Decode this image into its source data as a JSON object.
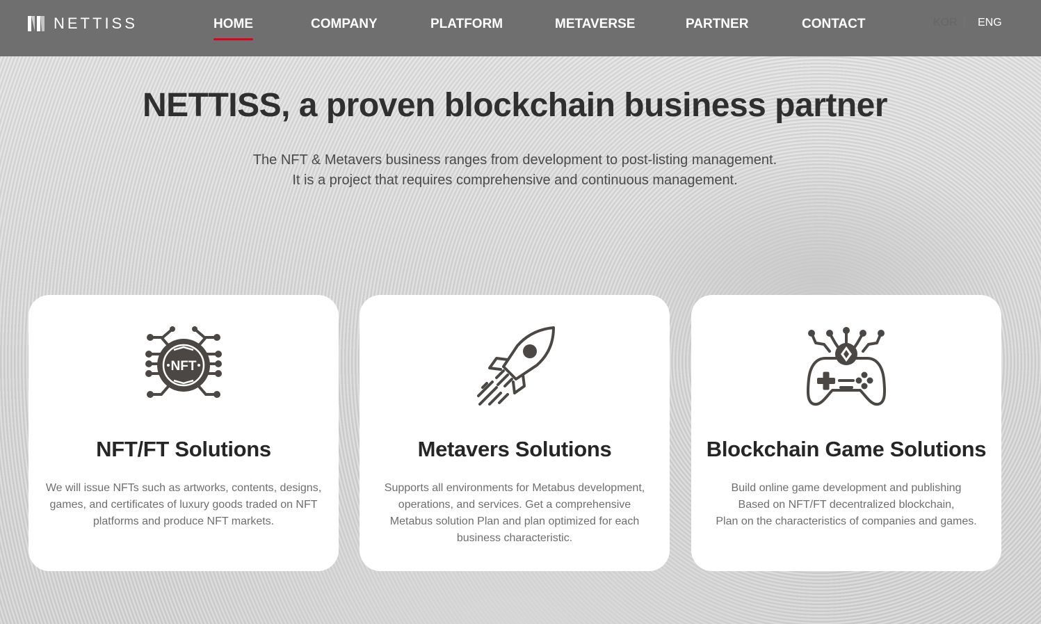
{
  "header": {
    "logo_text": "NETTISS",
    "nav": [
      {
        "label": "HOME",
        "active": true
      },
      {
        "label": "COMPANY",
        "active": false
      },
      {
        "label": "PLATFORM",
        "active": false
      },
      {
        "label": "METAVERSE",
        "active": false
      },
      {
        "label": "PARTNER",
        "active": false
      },
      {
        "label": "CONTACT",
        "active": false
      }
    ],
    "languages": {
      "kor": "KOR",
      "separator": "|",
      "eng": "ENG",
      "selected": "ENG"
    },
    "accent_color": "#e3001b"
  },
  "hero": {
    "title": "NETTISS, a proven blockchain business partner",
    "subtitle_line1": "The NFT & Metavers business ranges from development to post-listing management.",
    "subtitle_line2": "It is a project that requires comprehensive and continuous management."
  },
  "cards": [
    {
      "icon": "nft-chip-icon",
      "title": "NFT/FT Solutions",
      "icon_text": "NFT",
      "description": "We will issue NFTs such as artworks, contents, designs, games, and certificates of luxury goods traded on NFT platforms and produce NFT markets."
    },
    {
      "icon": "rocket-icon",
      "title": "Metavers Solutions",
      "description": "Supports all environments for Metabus development, operations, and services. Get a comprehensive Metabus solution Plan and plan optimized for each business characteristic."
    },
    {
      "icon": "game-controller-icon",
      "title": "Blockchain Game Solutions",
      "description_lines": [
        "Build online game development and publishing",
        "Based on NFT/FT decentralized blockchain,",
        "Plan on the characteristics of companies and games."
      ]
    }
  ]
}
